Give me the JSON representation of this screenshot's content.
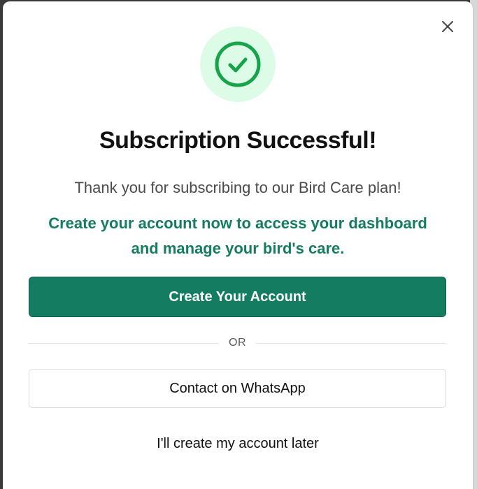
{
  "modal": {
    "title": "Subscription Successful!",
    "subtitle": "Thank you for subscribing to our Bird Care plan!",
    "cta_text_line1": "Create your account now to access your dashboard",
    "cta_text_line2": "and manage your bird's care.",
    "primary_button_label": "Create Your Account",
    "divider_label": "OR",
    "secondary_button_label": "Contact on WhatsApp",
    "later_link_label": "I'll create my account later",
    "icons": {
      "close": "close-icon",
      "success": "check-circle-icon"
    }
  },
  "colors": {
    "accent": "#147d61",
    "accent_text": "#147d5f",
    "success_circle_bg": "#dcfce7",
    "success_icon": "#16a34a"
  }
}
